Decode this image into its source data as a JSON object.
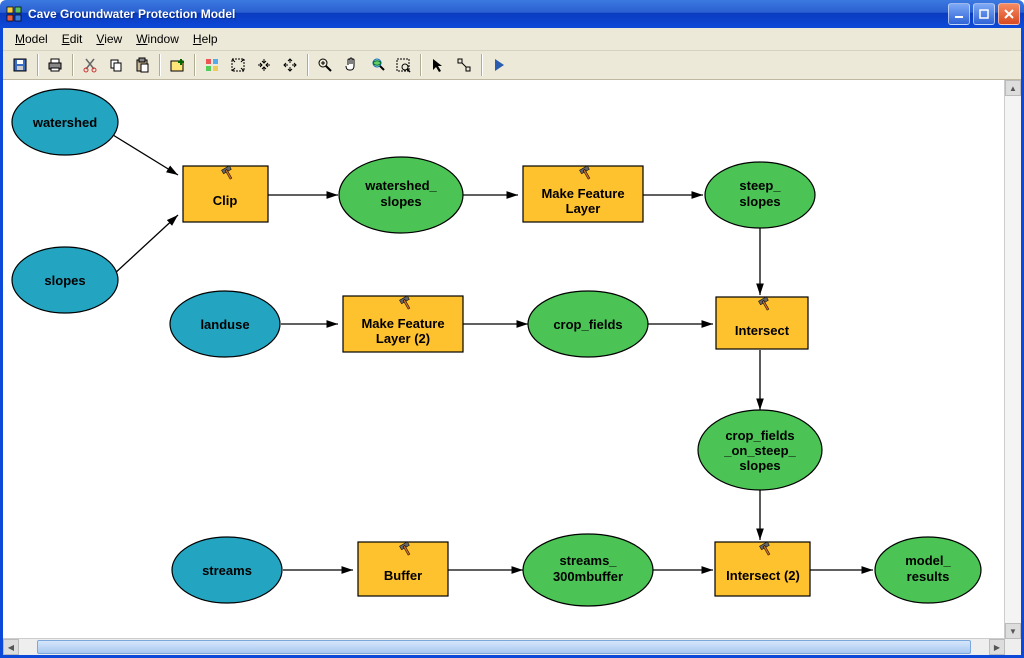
{
  "window": {
    "title": "Cave Groundwater Protection Model"
  },
  "menu": {
    "model": "Model",
    "edit": "Edit",
    "view": "View",
    "window": "Window",
    "help": "Help"
  },
  "nodes": {
    "watershed": "watershed",
    "slopes": "slopes",
    "clip": "Clip",
    "watershed_slopes_l1": "watershed_",
    "watershed_slopes_l2": "slopes",
    "make_feature_layer_l1": "Make Feature",
    "make_feature_layer_l2": "Layer",
    "steep_slopes_l1": "steep_",
    "steep_slopes_l2": "slopes",
    "landuse": "landuse",
    "make_feature_layer2_l1": "Make Feature",
    "make_feature_layer2_l2": "Layer (2)",
    "crop_fields": "crop_fields",
    "intersect": "Intersect",
    "crop_fields_on_l1": "crop_fields",
    "crop_fields_on_l2": "_on_steep_",
    "crop_fields_on_l3": "slopes",
    "streams": "streams",
    "buffer": "Buffer",
    "streams_300_l1": "streams_",
    "streams_300_l2": "300mbuffer",
    "intersect2": "Intersect (2)",
    "model_results_l1": "model_",
    "model_results_l2": "results"
  },
  "colors": {
    "input": "#23a5c2",
    "output": "#4bc355",
    "tool": "#ffc22f",
    "titlebar": "#0d49d8"
  }
}
